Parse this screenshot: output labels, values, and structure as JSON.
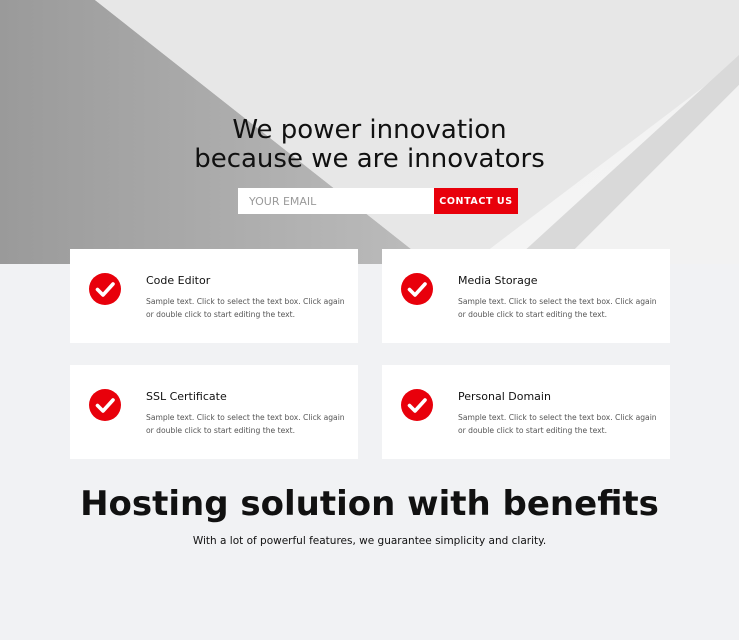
{
  "hero": {
    "headline_line1": "We power innovation",
    "headline_line2": "because we are innovators",
    "email_placeholder": "YOUR EMAIL",
    "contact_label": "CONTACT US"
  },
  "features": [
    {
      "title": "Code Editor",
      "text": "Sample text. Click to select the text box. Click again or double click to start editing the text.",
      "icon": "checkmark-icon"
    },
    {
      "title": "Media Storage",
      "text": "Sample text. Click to select the text box. Click again or double click to start editing the text.",
      "icon": "checkmark-icon"
    },
    {
      "title": "SSL Certificate",
      "text": "Sample text. Click to select the text box. Click again or double click to start editing the text.",
      "icon": "checkmark-icon"
    },
    {
      "title": "Personal Domain",
      "text": "Sample text. Click to select the text box. Click again or double click to start editing the text.",
      "icon": "checkmark-icon"
    }
  ],
  "benefits": {
    "title": "Hosting solution with benefits",
    "subtitle": "With a lot of powerful features, we guarantee simplicity and clarity."
  },
  "colors": {
    "accent": "#e8000b",
    "background": "#f1f2f4"
  }
}
